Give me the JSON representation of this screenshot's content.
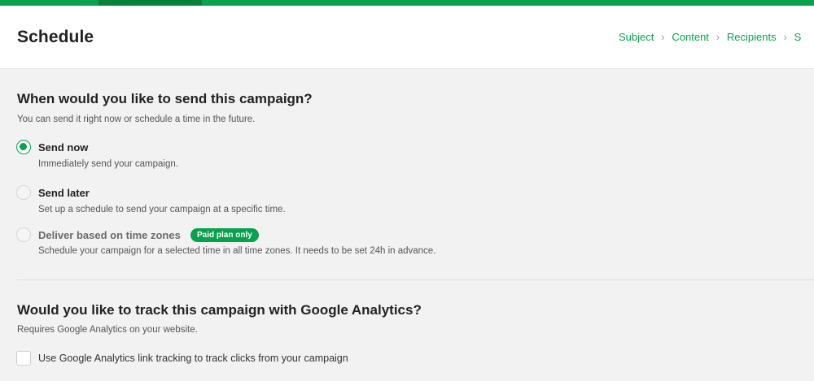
{
  "header": {
    "title": "Schedule",
    "breadcrumb": [
      "Subject",
      "Content",
      "Recipients",
      "S"
    ]
  },
  "when_section": {
    "title": "When would you like to send this campaign?",
    "subtitle": "You can send it right now or schedule a time in the future.",
    "options": [
      {
        "label": "Send now",
        "description": "Immediately send your campaign.",
        "selected": true
      },
      {
        "label": "Send later",
        "description": "Set up a schedule to send your campaign at a specific time.",
        "selected": false
      },
      {
        "label": "Deliver based on time zones",
        "badge": "Paid plan only",
        "description": "Schedule your campaign for a selected time in all time zones. It needs to be set 24h in advance.",
        "selected": false
      }
    ]
  },
  "analytics_section": {
    "title": "Would you like to track this campaign with Google Analytics?",
    "subtitle": "Requires Google Analytics on your website.",
    "checkbox_label": "Use Google Analytics link tracking to track clicks from your campaign",
    "checked": false
  },
  "colors": {
    "accent": "#09a14b",
    "accent_dark": "#07813c"
  }
}
